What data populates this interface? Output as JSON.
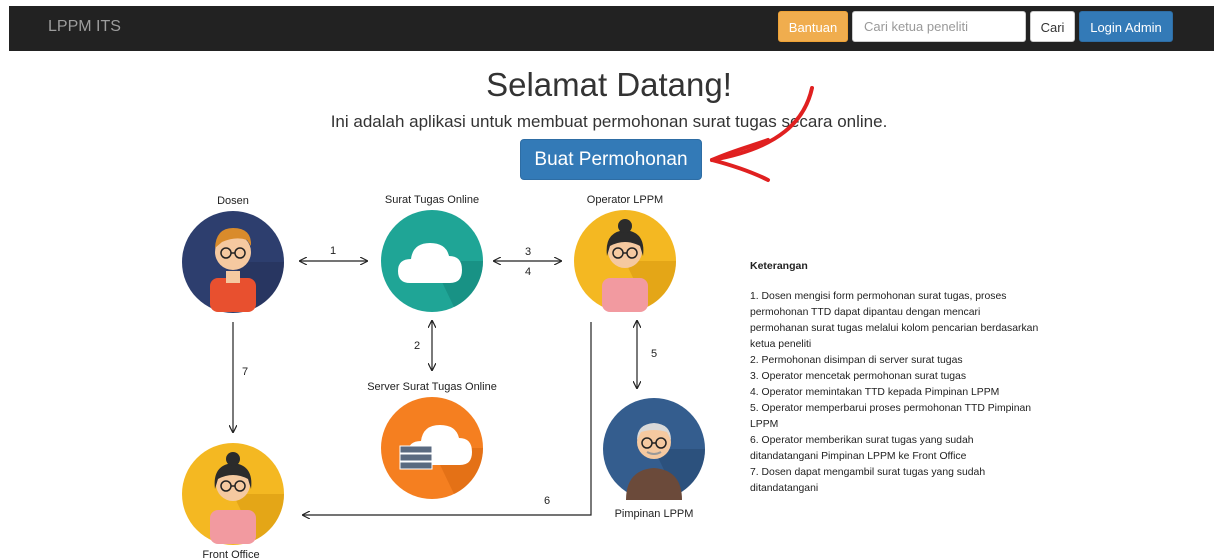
{
  "navbar": {
    "brand": "LPPM ITS",
    "help_label": "Bantuan",
    "search_placeholder": "Cari ketua peneliti",
    "search_button": "Cari",
    "login_label": "Login Admin"
  },
  "hero": {
    "title": "Selamat Datang!",
    "subtitle": "Ini adalah aplikasi untuk membuat permohonan surat tugas secara online.",
    "create_button": "Buat Permohonan"
  },
  "diagram": {
    "nodes": {
      "dosen": "Dosen",
      "surat_online": "Surat Tugas Online",
      "operator": "Operator LPPM",
      "server": "Server Surat Tugas Online",
      "pimpinan": "Pimpinan LPPM",
      "front_office": "Front Office"
    },
    "steps": [
      "1",
      "2",
      "3",
      "4",
      "5",
      "6",
      "7"
    ],
    "colors": {
      "blue_circle": "#2d3e6e",
      "teal_circle": "#1fa596",
      "yellow_circle": "#f4b822",
      "orange_circle": "#f57f20",
      "navy_circle": "#345d8e",
      "arrow_red": "#e02020"
    }
  },
  "notes": {
    "title": "Keterangan",
    "items": [
      "1. Dosen mengisi form permohonan surat tugas, proses permohonan TTD dapat dipantau dengan mencari permohanan surat tugas melalui kolom pencarian berdasarkan ketua peneliti",
      "2. Permohonan disimpan di server surat tugas",
      "3. Operator mencetak permohonan surat tugas",
      "4. Operator memintakan TTD kepada Pimpinan LPPM",
      "5. Operator memperbarui proses permohonan TTD Pimpinan LPPM",
      "6. Operator memberikan surat tugas yang sudah ditandatangani Pimpinan LPPM ke Front Office",
      "7. Dosen dapat mengambil surat tugas yang sudah ditandatangani"
    ]
  }
}
